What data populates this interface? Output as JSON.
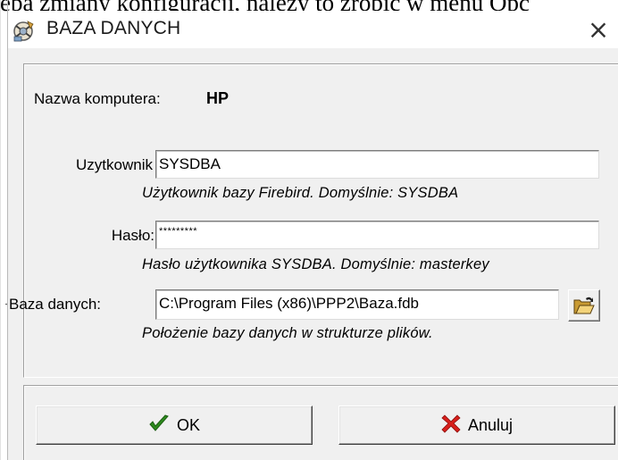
{
  "background": {
    "text": "eba zmiany konfiguracji, należy to zrobić w menu Opc"
  },
  "window": {
    "title": "BAZA DANYCH",
    "close_glyph": "×"
  },
  "form": {
    "computer_label": "Nazwa komputera:",
    "computer_value": "HP",
    "user_label": "Uzytkownik",
    "user_value": "SYSDBA",
    "user_hint": "Użytkownik bazy Firebird. Domyślnie: SYSDBA",
    "password_label": "Hasło:",
    "password_value": "*********",
    "password_hint": "Hasło użytkownika SYSDBA. Domyślnie: masterkey",
    "db_label": "Baza danych:",
    "db_value": "C:\\Program Files (x86)\\PPP2\\Baza.fdb",
    "db_hint": "Położenie bazy danych w strukturze plików."
  },
  "buttons": {
    "ok_label": "OK",
    "cancel_label": "Anuluj"
  },
  "icons": {
    "title_icon": "database-app-icon",
    "browse_icon": "open-folder-icon",
    "ok_icon": "checkmark-icon",
    "cancel_icon": "red-x-icon"
  },
  "colors": {
    "dialog_bg": "#f0f0f0",
    "ok_green": "#2e8b1e",
    "cancel_red": "#d8201c",
    "folder_yellow": "#e8c25a"
  }
}
